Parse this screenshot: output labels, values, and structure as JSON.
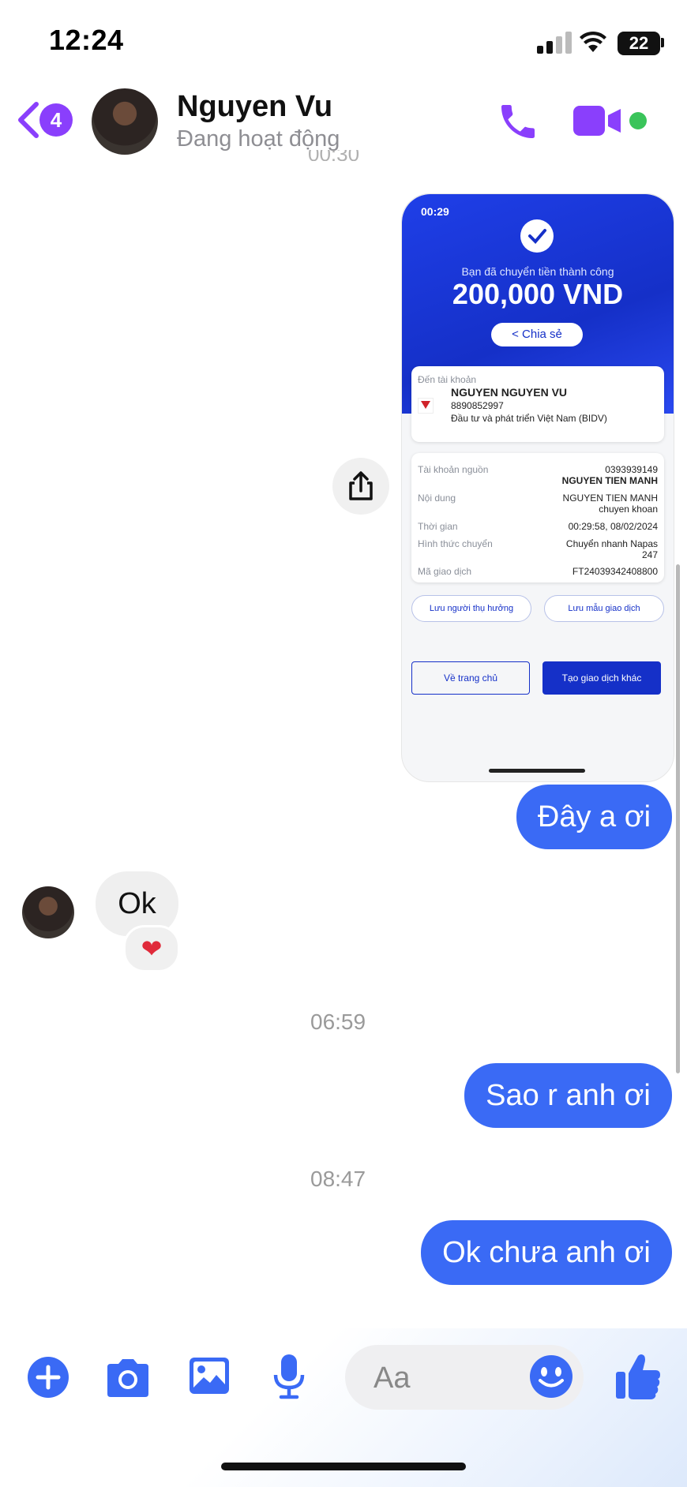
{
  "status_bar": {
    "time": "12:24",
    "battery": "22"
  },
  "header": {
    "back_badge": "4",
    "name": "Nguyen Vu",
    "status": "Đang hoạt động"
  },
  "colors": {
    "accent_purple": "#8a3ffc",
    "bubble_blue": "#3a6af5",
    "online_green": "#3ac45a",
    "bank_blue": "#1530c8"
  },
  "icons": [
    "chevron-left-icon",
    "phone-icon",
    "video-camera-icon",
    "share-icon",
    "plus-circle-icon",
    "camera-icon",
    "image-icon",
    "microphone-icon",
    "emoji-icon",
    "thumbs-up-icon",
    "heart-icon",
    "check-icon"
  ],
  "shared_screenshot": {
    "time": "00:29",
    "success_text": "Bạn đã chuyển tiền thành công",
    "amount": "200,000 VND",
    "share_label": "Chia sẻ",
    "to_account_label": "Đến tài khoản",
    "recipient_name": "NGUYEN NGUYEN VU",
    "recipient_account": "8890852997",
    "recipient_bank": "Đầu tư và phát triển Việt Nam (BIDV)",
    "details": [
      {
        "label": "Tài khoản nguồn",
        "value": "0393939149",
        "value2": "NGUYEN TIEN MANH"
      },
      {
        "label": "Nội dung",
        "value": "NGUYEN TIEN MANH",
        "value2": "chuyen khoan"
      },
      {
        "label": "Thời gian",
        "value": "00:29:58, 08/02/2024",
        "value2": ""
      },
      {
        "label": "Hình thức chuyển",
        "value": "Chuyển nhanh Napas",
        "value2": "247"
      },
      {
        "label": "Mã giao dịch",
        "value": "FT24039342408800",
        "value2": ""
      }
    ],
    "save_recipient": "Lưu người thụ hưởng",
    "save_template": "Lưu mẫu giao dịch",
    "home_button": "Về trang chủ",
    "new_transaction_button": "Tạo giao dịch khác"
  },
  "messages": {
    "msg1": "Đây a ơi",
    "msg2": "Ok",
    "msg2_reaction": "❤",
    "ts1": "06:59",
    "msg3": "Sao r anh ơi",
    "ts2": "08:47",
    "msg4": "Ok chưa anh ơi"
  },
  "composer": {
    "placeholder": "Aa"
  }
}
